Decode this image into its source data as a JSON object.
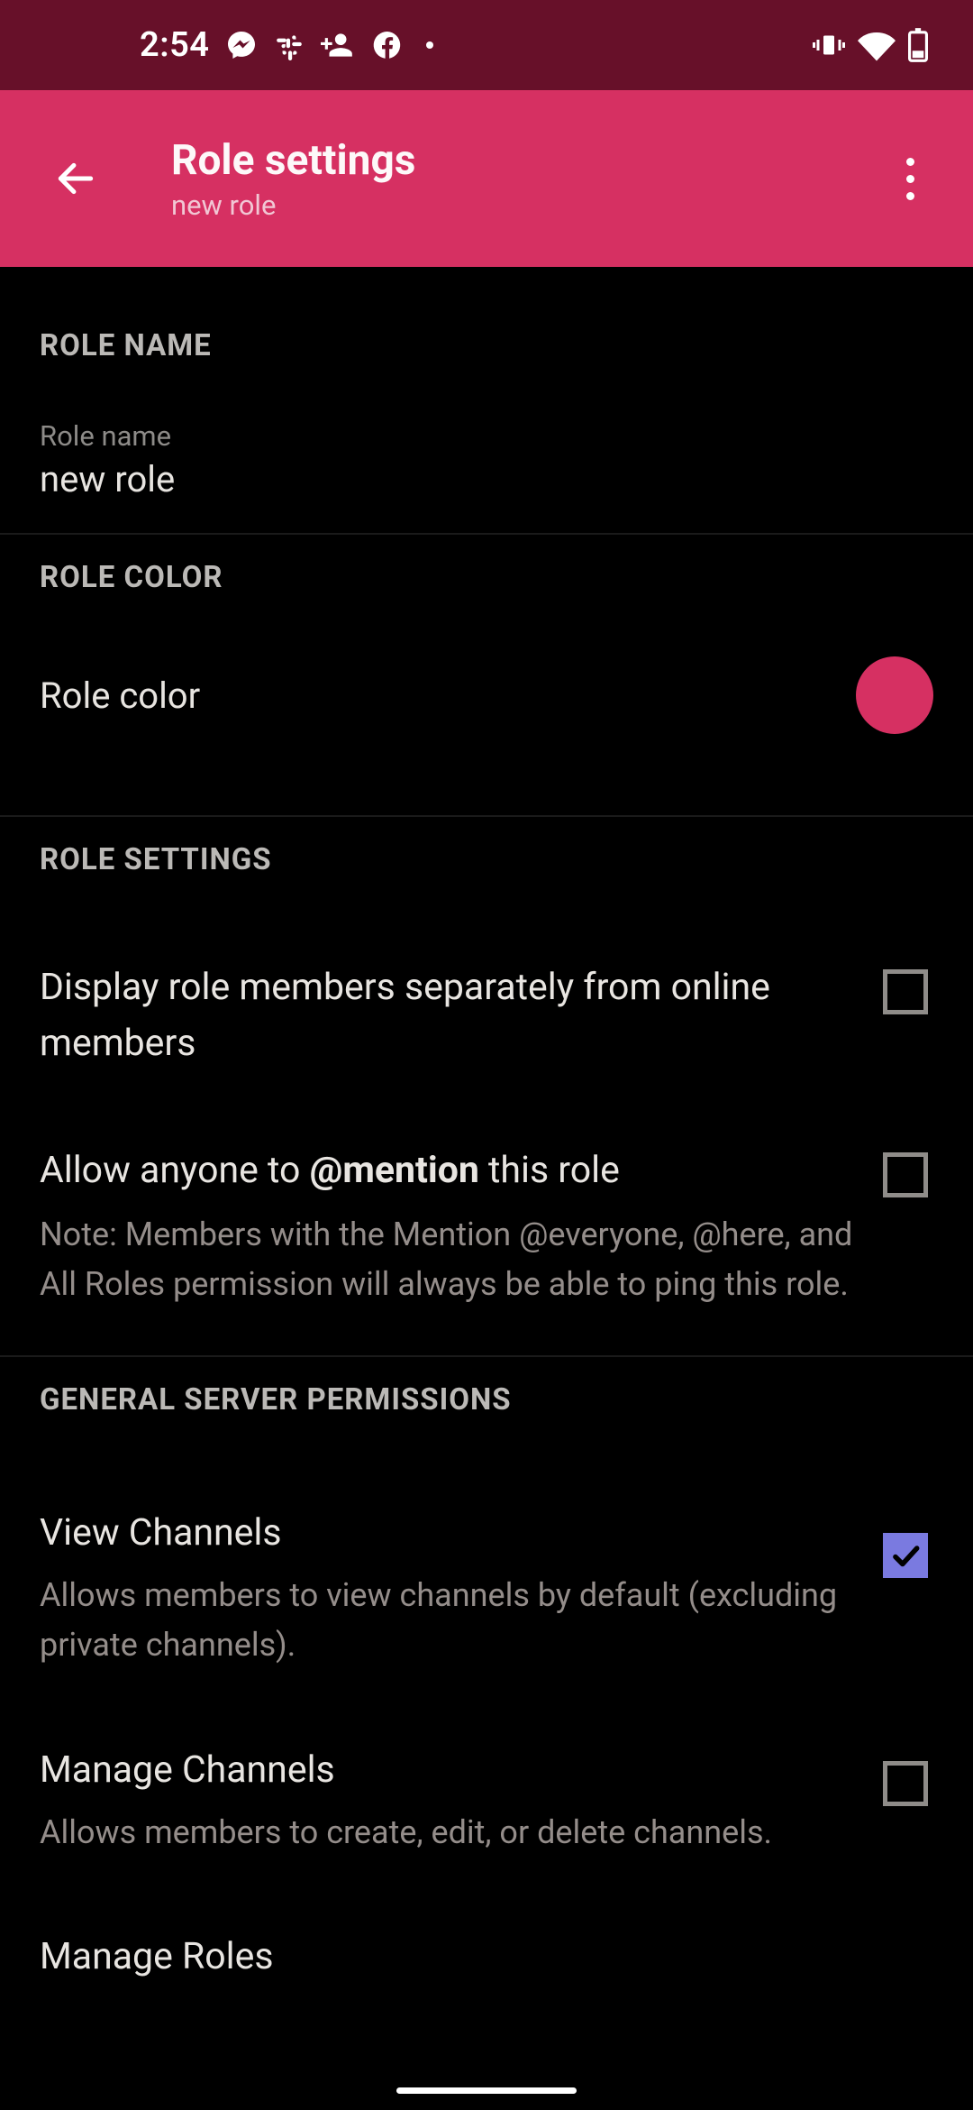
{
  "status": {
    "time": "2:54"
  },
  "header": {
    "title": "Role settings",
    "subtitle": "new role"
  },
  "sections": {
    "role_name": {
      "header": "ROLE NAME",
      "label": "Role name",
      "value": "new role"
    },
    "role_color": {
      "header": "ROLE COLOR",
      "label": "Role color",
      "color": "#d63062"
    },
    "role_settings": {
      "header": "ROLE SETTINGS",
      "display_separately": {
        "title": "Display role members separately from online members",
        "checked": false
      },
      "allow_mention": {
        "title_pre": "Allow anyone to ",
        "title_bold": "@mention",
        "title_post": " this role",
        "note": "Note: Members with the Mention @everyone, @here, and All Roles permission will always be able to ping this role.",
        "checked": false
      }
    },
    "general_permissions": {
      "header": "GENERAL SERVER PERMISSIONS",
      "view_channels": {
        "title": "View Channels",
        "desc": "Allows members to view channels by default (excluding private channels).",
        "checked": true
      },
      "manage_channels": {
        "title": "Manage Channels",
        "desc": "Allows members to create, edit, or delete channels.",
        "checked": false
      },
      "manage_roles": {
        "title": "Manage Roles"
      }
    }
  }
}
